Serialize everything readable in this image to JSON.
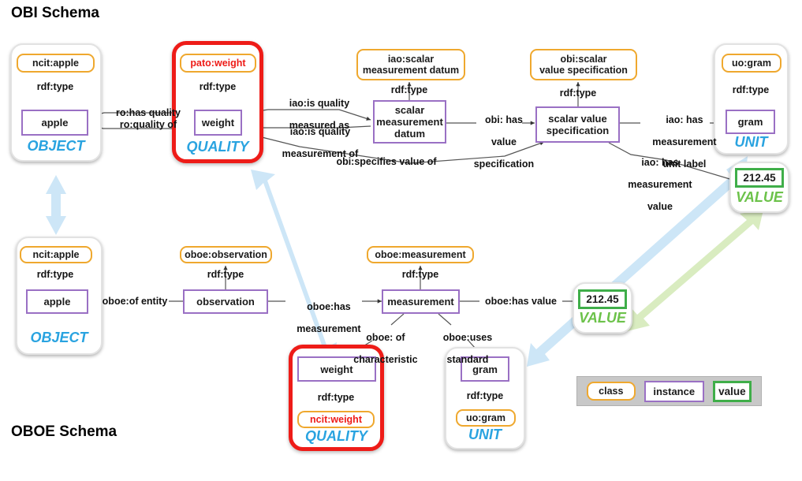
{
  "titles": {
    "obi": "OBI Schema",
    "oboe": "OBOE Schema"
  },
  "colors": {
    "class_border": "#efa82e",
    "instance_border": "#9a70c4",
    "value_border": "#3fae49",
    "highlight_red": "#ee1c18",
    "group_label_blue": "#29a3e0",
    "value_label_green": "#6cc24a",
    "link_blue": "#cde6f7",
    "link_green": "#d9ecc0",
    "legend_bg": "#c8c8c8"
  },
  "obi": {
    "object_group": {
      "label": "OBJECT",
      "class": "ncit:apple",
      "instance": "apple",
      "rdf_type": "rdf:type"
    },
    "quality_group": {
      "label": "QUALITY",
      "class": "pato:weight",
      "instance": "weight",
      "rdf_type": "rdf:type",
      "highlighted": true
    },
    "smd_group": {
      "class": "iao:scalar\nmeasurement datum",
      "class_line1": "iao:scalar",
      "class_line2": "measurement datum",
      "instance": "scalar\nmeasurement\ndatum",
      "instance_line1": "scalar",
      "instance_line2": "measurement",
      "instance_line3": "datum",
      "rdf_type": "rdf:type"
    },
    "svs_group": {
      "class_line1": "obi:scalar",
      "class_line2": "value specification",
      "instance_line1": "scalar value",
      "instance_line2": "specification",
      "rdf_type": "rdf:type"
    },
    "unit_group": {
      "label": "UNIT",
      "class": "uo:gram",
      "instance": "gram",
      "rdf_type": "rdf:type"
    },
    "value_group": {
      "label": "VALUE",
      "value": "212.45"
    },
    "edges": {
      "has_quality": "ro:has quality",
      "quality_of": "ro:quality of",
      "is_quality_measured_as_l1": "iao:is quality",
      "is_quality_measured_as_l2": "measured as",
      "is_quality_measurement_of_l1": "iao:is quality",
      "is_quality_measurement_of_l2": "measurement of",
      "specifies_value_of": "obi:specifies value of",
      "has_value_specification_l1": "obi: has",
      "has_value_specification_l2": "value",
      "has_value_specification_l3": "specification",
      "has_measurement_unit_label_l1": "iao: has",
      "has_measurement_unit_label_l2": "measurement",
      "has_measurement_unit_label_l3": "unit label",
      "has_measurement_value_l1": "iao: has",
      "has_measurement_value_l2": "measurement",
      "has_measurement_value_l3": "value"
    }
  },
  "oboe": {
    "object_group": {
      "label": "OBJECT",
      "class": "ncit:apple",
      "instance": "apple",
      "rdf_type": "rdf:type"
    },
    "observation_group": {
      "class": "oboe:observation",
      "instance": "observation",
      "rdf_type": "rdf:type"
    },
    "measurement_group": {
      "class": "oboe:measurement",
      "instance": "measurement",
      "rdf_type": "rdf:type"
    },
    "quality_group": {
      "label": "QUALITY",
      "instance": "weight",
      "class": "ncit:weight",
      "rdf_type": "rdf:type",
      "highlighted": true
    },
    "unit_group": {
      "label": "UNIT",
      "instance": "gram",
      "class": "uo:gram",
      "rdf_type": "rdf:type"
    },
    "value_group": {
      "label": "VALUE",
      "value": "212.45"
    },
    "edges": {
      "of_entity": "oboe:of entity",
      "has_measurement_l1": "oboe:has",
      "has_measurement_l2": "measurement",
      "of_characteristic_l1": "oboe: of",
      "of_characteristic_l2": "characteristic",
      "uses_standard_l1": "oboe:uses",
      "uses_standard_l2": "standard",
      "has_value": "oboe:has value"
    }
  },
  "legend": {
    "class": "class",
    "instance": "instance",
    "value": "value"
  }
}
